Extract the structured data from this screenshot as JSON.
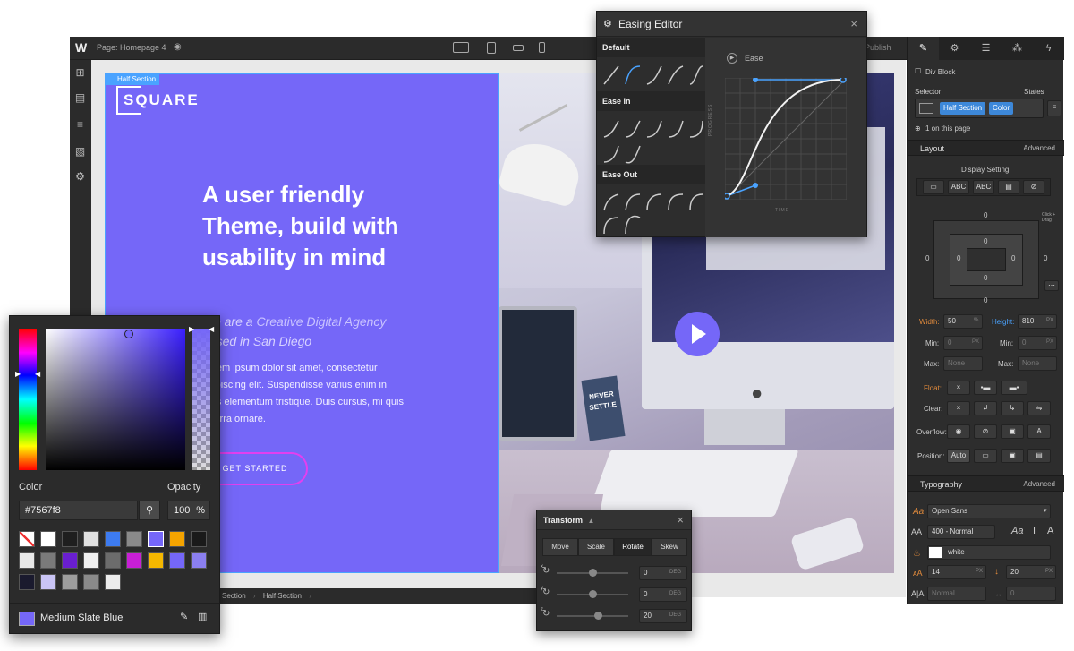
{
  "topbar": {
    "logo": "W",
    "page_label": "Page: Homepage 4",
    "publish_label": "Publish"
  },
  "canvas": {
    "section_tag": "Half Section",
    "brand": "SQUARE",
    "headline": "A user friendly Theme, build with usability in mind",
    "subtitle_prefix": "We are a ",
    "subtitle_emphasis": "Creative Digital Agency",
    "subtitle_suffix": "based in San Diego",
    "body": "Lorem ipsum dolor sit amet, consectetur adipiscing elit. Suspendisse varius enim in eros elementum tristique. Duis cursus, mi quis viverra ornare.",
    "cta": "GET STARTED",
    "poster_line1": "NEVER",
    "poster_line2": "SETTLE"
  },
  "breadcrumb": {
    "items": [
      "Section",
      "Half Section"
    ]
  },
  "easing": {
    "title": "Easing Editor",
    "categories": [
      "Default",
      "Ease In",
      "Ease Out"
    ],
    "current": "Ease",
    "y_axis": "PROGRESS",
    "x_axis": "TIME"
  },
  "transform": {
    "title": "Transform",
    "tabs": [
      "Move",
      "Scale",
      "Rotate",
      "Skew"
    ],
    "active_tab": "Rotate",
    "rows": [
      {
        "axis": "x",
        "value": "0",
        "unit": "DEG"
      },
      {
        "axis": "y",
        "value": "0",
        "unit": "DEG"
      },
      {
        "axis": "z",
        "value": "20",
        "unit": "DEG"
      }
    ]
  },
  "picker": {
    "color_label": "Color",
    "opacity_label": "Opacity",
    "hex": "#7567f8",
    "opacity": "100",
    "opacity_unit": "%",
    "swatch_name": "Medium Slate Blue",
    "colors": {
      "current": "#7567f8",
      "swatches": [
        "none",
        "#ffffff",
        "#1f1f1f",
        "#e0e0e0",
        "#3d7bf0",
        "#8a8a8a",
        "#7567f8",
        "#f5a400",
        "#1a1a1a",
        "#e8e8e8",
        "#7a7a7a",
        "#6a1fd0",
        "#f0f0f0",
        "#6c6c6c",
        "#c81fd6",
        "#f5b800",
        "#7567f8",
        "#8b7ff0",
        "#1a1a2e",
        "#c9c4f5",
        "#9d9d9d",
        "#8a8a8a",
        "#ececec"
      ]
    }
  },
  "panel": {
    "selected_element": "Div Block",
    "selector_label": "Selector:",
    "states_label": "States",
    "classes": [
      "Half Section",
      "Color"
    ],
    "on_page": "1 on this page",
    "layout_title": "Layout",
    "advanced_label": "Advanced",
    "display_setting": "Display Setting",
    "display_options": [
      "ABC",
      "ABC"
    ],
    "box_values": [
      "0",
      "0",
      "0",
      "0",
      "0",
      "0",
      "0",
      "0"
    ],
    "click_drag": "Click + Drag",
    "width_label": "Width:",
    "width_value": "50",
    "width_unit": "%",
    "height_label": "Height:",
    "height_value": "810",
    "height_unit": "PX",
    "min_label": "Min:",
    "min_value": "0",
    "min_unit": "PX",
    "max_label": "Max:",
    "max_value": "None",
    "float_label": "Float:",
    "clear_label": "Clear:",
    "overflow_label": "Overflow:",
    "position_label": "Position:",
    "position_value": "Auto",
    "typography_title": "Typography",
    "font_family": "Open Sans",
    "font_weight": "400 - Normal",
    "text_color": "white",
    "font_size": "14",
    "font_size_unit": "PX",
    "line_height": "20",
    "line_height_unit": "PX",
    "style_value": "Normal",
    "letter_spacing": "0"
  }
}
